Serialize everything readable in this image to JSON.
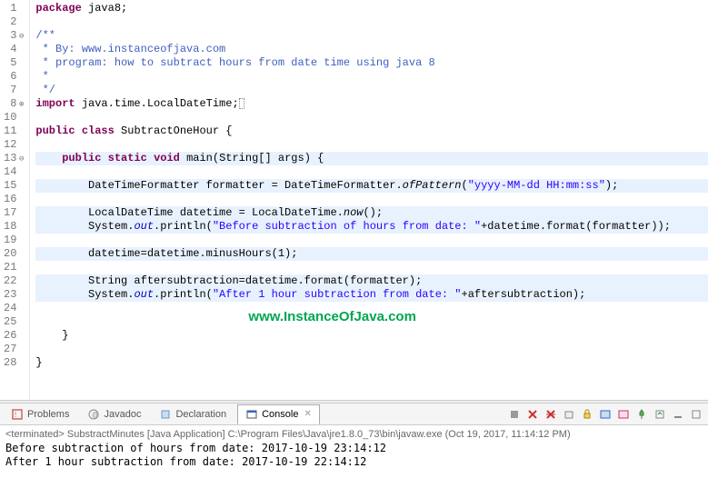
{
  "code": {
    "lines": [
      {
        "n": "1",
        "fold": "",
        "cls": "",
        "html": "<span class='kw'>package</span> java8;"
      },
      {
        "n": "2",
        "fold": "",
        "cls": "",
        "html": ""
      },
      {
        "n": "3",
        "fold": "⊖",
        "cls": "",
        "html": "<span class='doccomment'>/**</span>"
      },
      {
        "n": "4",
        "fold": "",
        "cls": "",
        "html": "<span class='doccomment'> * By: www.instanceofjava.com</span>"
      },
      {
        "n": "5",
        "fold": "",
        "cls": "",
        "html": "<span class='doccomment'> * program: how to subtract hours from date time using java 8</span>"
      },
      {
        "n": "6",
        "fold": "",
        "cls": "",
        "html": "<span class='doccomment'> *</span>"
      },
      {
        "n": "7",
        "fold": "",
        "cls": "",
        "html": "<span class='doccomment'> */</span>"
      },
      {
        "n": "8",
        "fold": "⊕",
        "cls": "",
        "html": "<span class='kw'>import</span> java.time.LocalDateTime;<span class='caret-box'></span>"
      },
      {
        "n": "10",
        "fold": "",
        "cls": "",
        "html": ""
      },
      {
        "n": "11",
        "fold": "",
        "cls": "",
        "html": "<span class='kw'>public</span> <span class='kw'>class</span> SubtractOneHour {"
      },
      {
        "n": "12",
        "fold": "",
        "cls": "",
        "html": ""
      },
      {
        "n": "13",
        "fold": "⊖",
        "cls": "hl",
        "html": "    <span class='kw'>public</span> <span class='kw'>static</span> <span class='kw'>void</span> main(String[] args) {"
      },
      {
        "n": "14",
        "fold": "",
        "cls": "",
        "html": ""
      },
      {
        "n": "15",
        "fold": "",
        "cls": "hl",
        "html": "        DateTimeFormatter formatter = DateTimeFormatter.<span class='static-call'>ofPattern</span>(<span class='string'>\"yyyy-MM-dd HH:mm:ss\"</span>);"
      },
      {
        "n": "16",
        "fold": "",
        "cls": "",
        "html": ""
      },
      {
        "n": "17",
        "fold": "",
        "cls": "hl",
        "html": "        LocalDateTime datetime = LocalDateTime.<span class='static-call'>now</span>();"
      },
      {
        "n": "18",
        "fold": "",
        "cls": "hl",
        "html": "        System.<span class='field'>out</span>.println(<span class='string'>\"Before subtraction of hours from date: \"</span>+datetime.format(formatter));"
      },
      {
        "n": "19",
        "fold": "",
        "cls": "",
        "html": ""
      },
      {
        "n": "20",
        "fold": "",
        "cls": "hl",
        "html": "        datetime=datetime.minusHours(1);"
      },
      {
        "n": "21",
        "fold": "",
        "cls": "",
        "html": ""
      },
      {
        "n": "22",
        "fold": "",
        "cls": "hl",
        "html": "        String aftersubtraction=datetime.format(formatter);"
      },
      {
        "n": "23",
        "fold": "",
        "cls": "hl",
        "html": "        System.<span class='field'>out</span>.println(<span class='string'>\"After 1 hour subtraction from date: \"</span>+aftersubtraction);"
      },
      {
        "n": "24",
        "fold": "",
        "cls": "",
        "html": ""
      },
      {
        "n": "25",
        "fold": "",
        "cls": "",
        "html": ""
      },
      {
        "n": "26",
        "fold": "",
        "cls": "",
        "html": "    }"
      },
      {
        "n": "27",
        "fold": "",
        "cls": "",
        "html": ""
      },
      {
        "n": "28",
        "fold": "",
        "cls": "",
        "html": "}"
      }
    ]
  },
  "watermark": "www.InstanceOfJava.com",
  "tabs": {
    "problems": "Problems",
    "javadoc": "Javadoc",
    "declaration": "Declaration",
    "console": "Console"
  },
  "console": {
    "meta": "<terminated> SubstractMinutes [Java Application] C:\\Program Files\\Java\\jre1.8.0_73\\bin\\javaw.exe (Oct 19, 2017, 11:14:12 PM)",
    "line1": "Before subtraction of hours from date: 2017-10-19 23:14:12",
    "line2": "After 1 hour subtraction from date: 2017-10-19 22:14:12"
  }
}
